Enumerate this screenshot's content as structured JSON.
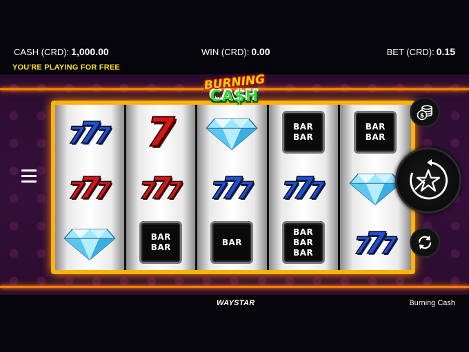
{
  "hud": {
    "cash_label": "CASH (CRD):",
    "cash_value": "1,000.00",
    "win_label": "WIN (CRD):",
    "win_value": "0.00",
    "bet_label": "BET (CRD):",
    "bet_value": "0.15",
    "free_play_notice": "YOU'RE PLAYING FOR FREE"
  },
  "logo": {
    "line1": "BURNING",
    "line2": "CA$H"
  },
  "reels": [
    [
      "triple-seven-blue",
      "triple-seven-red",
      "diamond"
    ],
    [
      "single-seven-red",
      "triple-seven-red",
      "double-bar"
    ],
    [
      "diamond",
      "triple-seven-blue",
      "single-bar"
    ],
    [
      "double-bar",
      "triple-seven-blue",
      "triple-bar"
    ],
    [
      "double-bar",
      "diamond",
      "triple-seven-blue"
    ]
  ],
  "symbols": {
    "seven": "7",
    "bar": "BAR"
  },
  "footer": {
    "provider": "WAYSTAR",
    "game_name": "Burning Cash"
  },
  "icons": {
    "menu": "hamburger-icon",
    "coins": "coin-stack-icon",
    "spin": "star-spin-icon",
    "autoplay": "autoplay-arrows-icon"
  },
  "colors": {
    "accent_yellow": "#ffe11a",
    "frame_gold": "#ffb20a",
    "glow_orange": "#ff7a10",
    "stage_purple": "#2a0c2e"
  }
}
